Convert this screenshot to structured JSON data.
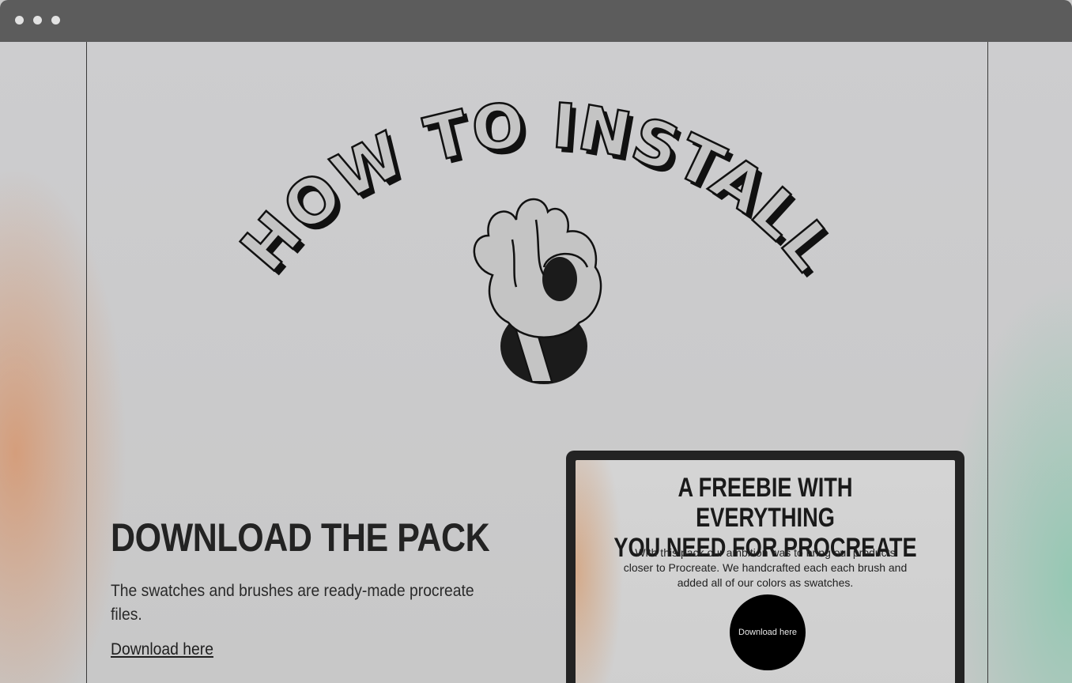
{
  "window": {
    "controls": [
      "window-dot-icon",
      "window-dot-icon",
      "window-dot-icon"
    ]
  },
  "hero": {
    "headline": "HOW TO INSTALL",
    "illustration": "ok-hand-icon"
  },
  "download_section": {
    "title": "DOWNLOAD THE PACK",
    "description": "The swatches and brushes are ready-made procreate files.",
    "link_label": "Download here"
  },
  "device_preview": {
    "title_line1": "A FREEBIE WITH EVERYTHING",
    "title_line2": "YOU NEED FOR PROCREATE",
    "body": "With this pack our ambition was to bring our products closer to Procreate. We handcrafted each each brush and added all of our colors as swatches.",
    "button_label": "Download here"
  },
  "colors": {
    "titlebar": "#5c5c5c",
    "accent_left": "#d6966e",
    "accent_right": "#8cc8af",
    "text_dark": "#232323"
  }
}
